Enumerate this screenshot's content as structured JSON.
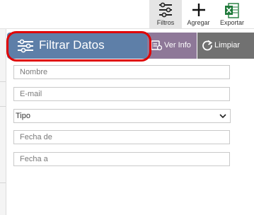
{
  "toolbar": {
    "filtros": {
      "label": "Filtros",
      "icon": "sliders-icon"
    },
    "agregar": {
      "label": "Agregar",
      "icon": "plus-icon"
    },
    "exportar": {
      "label": "Exportar",
      "icon": "excel-icon"
    }
  },
  "actions": {
    "filtrar_label": "Filtrar Datos",
    "verinfo_label": "Ver Info",
    "limpiar_label": "Limpiar"
  },
  "form": {
    "nombre_placeholder": "Nombre",
    "email_placeholder": "E-mail",
    "tipo_value": "Tipo",
    "fecha_de_placeholder": "Fecha de",
    "fecha_a_placeholder": "Fecha a"
  },
  "colors": {
    "filtrar_bg": "#5e7fa8",
    "verinfo_bg": "#8e7898",
    "limpiar_bg": "#717171",
    "highlight": "#e00000",
    "excel_green": "#1f7a3a"
  }
}
